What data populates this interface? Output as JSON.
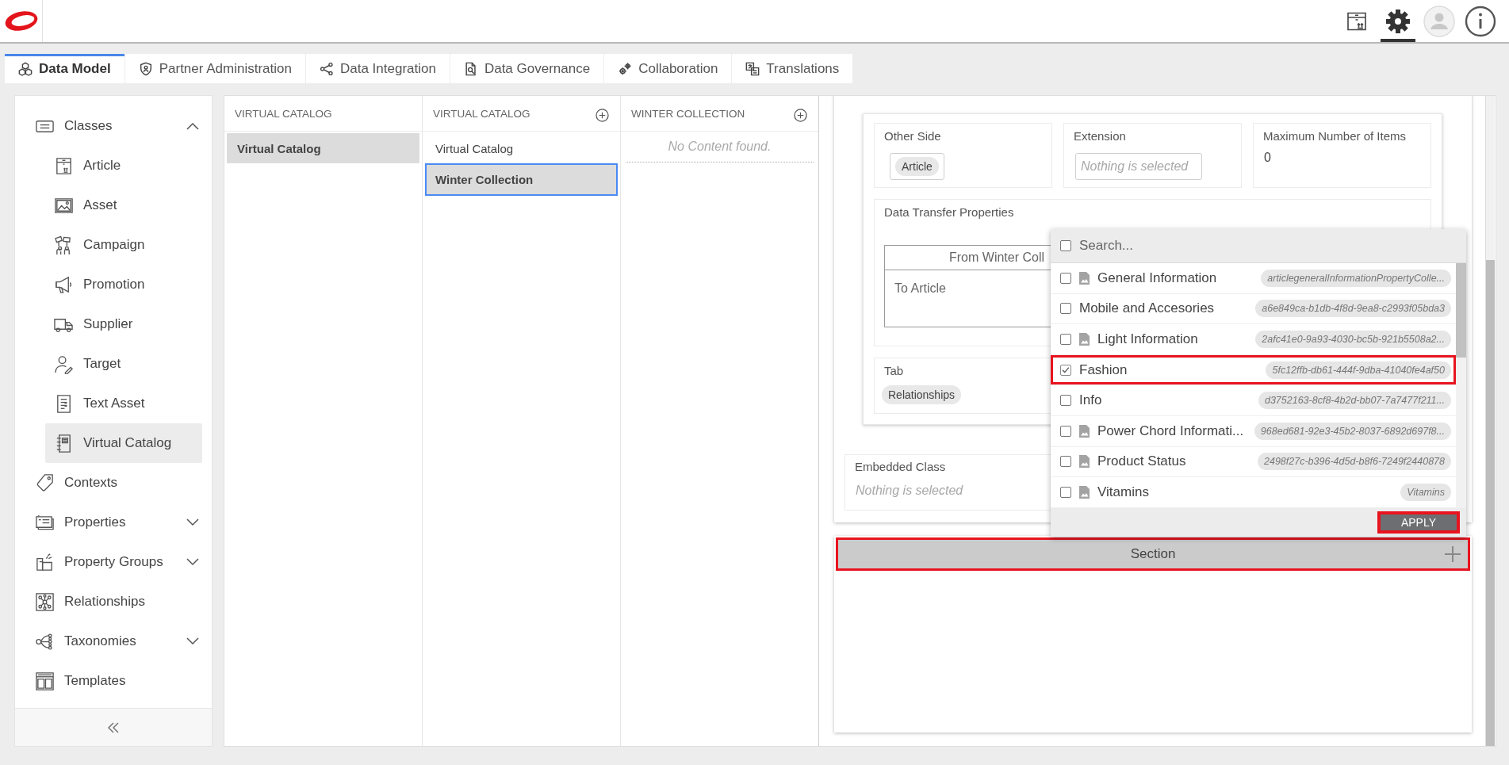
{
  "header": {
    "tools": [
      {
        "selected": false
      },
      {
        "selected": true
      },
      {
        "selected": false
      },
      {
        "selected": false
      }
    ]
  },
  "tabs": [
    {
      "label": "Data Model",
      "selected": true
    },
    {
      "label": "Partner Administration",
      "selected": false
    },
    {
      "label": "Data Integration",
      "selected": false
    },
    {
      "label": "Data Governance",
      "selected": false
    },
    {
      "label": "Collaboration",
      "selected": false
    },
    {
      "label": "Translations",
      "selected": false
    }
  ],
  "sidebar": {
    "items": [
      {
        "label": "Classes",
        "selected": false,
        "expanded": true,
        "children": [
          {
            "label": "Article",
            "selected": false
          },
          {
            "label": "Asset",
            "selected": false
          },
          {
            "label": "Campaign",
            "selected": false
          },
          {
            "label": "Promotion",
            "selected": false
          },
          {
            "label": "Supplier",
            "selected": false
          },
          {
            "label": "Target",
            "selected": false
          },
          {
            "label": "Text Asset",
            "selected": false
          },
          {
            "label": "Virtual Catalog",
            "selected": true
          }
        ]
      },
      {
        "label": "Contexts",
        "selected": false
      },
      {
        "label": "Properties",
        "selected": false,
        "expanded": false
      },
      {
        "label": "Property Groups",
        "selected": false,
        "expanded": false
      },
      {
        "label": "Relationships",
        "selected": false
      },
      {
        "label": "Taxonomies",
        "selected": false,
        "expanded": false
      },
      {
        "label": "Templates",
        "selected": false
      }
    ]
  },
  "columns": [
    {
      "title": "VIRTUAL CATALOG",
      "can_add": false,
      "items": [
        {
          "label": "Virtual Catalog",
          "selected": true,
          "focused": false
        }
      ]
    },
    {
      "title": "VIRTUAL CATALOG",
      "can_add": true,
      "items": [
        {
          "label": "Virtual Catalog",
          "selected": false,
          "focused": false
        },
        {
          "label": "Winter Collection",
          "selected": true,
          "focused": true
        }
      ]
    },
    {
      "title": "WINTER COLLECTION",
      "can_add": true,
      "empty_text": "No Content found."
    }
  ],
  "relationship": {
    "fields": [
      {
        "kind": "chips",
        "label": "Other Side",
        "value": "Article"
      },
      {
        "kind": "select",
        "label": "Extension",
        "placeholder": "Nothing is selected"
      },
      {
        "kind": "number",
        "label": "Maximum Number of Items",
        "value": "0"
      }
    ],
    "data_transfer": {
      "label": "Data Transfer Properties",
      "header": "From Winter Coll",
      "row": "To Article"
    },
    "tab": {
      "label": "Tab",
      "value": "Relationships"
    }
  },
  "embedded_class": {
    "label": "Embedded Class",
    "placeholder": "Nothing is selected"
  },
  "dropdown": {
    "search": {
      "placeholder": "Search...",
      "checked": false
    },
    "options": [
      {
        "label": "General Information",
        "has_icon": true,
        "code": "articlegeneralInformationPropertyColle...",
        "checked": false,
        "highlighted": false
      },
      {
        "label": "Mobile and Accesories",
        "has_icon": false,
        "code": "a6e849ca-b1db-4f8d-9ea8-c2993f05bda3",
        "checked": false,
        "highlighted": false
      },
      {
        "label": "Light Information",
        "has_icon": true,
        "code": "2afc41e0-9a93-4030-bc5b-921b5508a2...",
        "checked": false,
        "highlighted": false
      },
      {
        "label": "Fashion",
        "has_icon": false,
        "code": "5fc12ffb-db61-444f-9dba-41040fe4af50",
        "checked": true,
        "highlighted": true
      },
      {
        "label": "Info",
        "has_icon": false,
        "code": "d3752163-8cf8-4b2d-bb07-7a7477f211...",
        "checked": false,
        "highlighted": false
      },
      {
        "label": "Power Chord Informati...",
        "has_icon": true,
        "code": "968ed681-92e3-45b2-8037-6892d697f8...",
        "checked": false,
        "highlighted": false
      },
      {
        "label": "Product Status",
        "has_icon": true,
        "code": "2498f27c-b396-4d5d-b8f6-7249f2440878",
        "checked": false,
        "highlighted": false
      },
      {
        "label": "Vitamins",
        "has_icon": true,
        "code": "Vitamins",
        "checked": false,
        "highlighted": false
      }
    ],
    "apply": {
      "label": "APPLY",
      "highlighted": true
    }
  },
  "section": {
    "title": "Section",
    "highlighted": true
  }
}
